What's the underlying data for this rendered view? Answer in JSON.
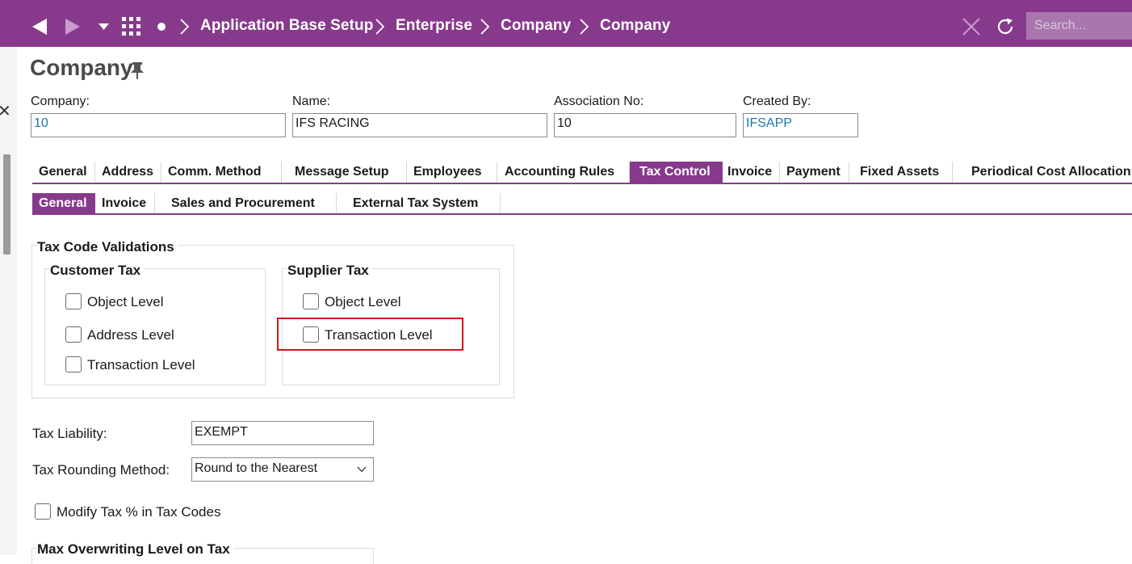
{
  "topbar": {
    "breadcrumb": [
      "Application Base Setup",
      "Enterprise",
      "Company",
      "Company"
    ],
    "search_placeholder": "Search...",
    "icons": [
      "back-arrow-icon",
      "forward-arrow-icon",
      "dropdown-icon",
      "apps-grid-icon",
      "dot-icon",
      "close-icon",
      "refresh-icon"
    ]
  },
  "page": {
    "title": "Company"
  },
  "header_fields": {
    "company_label": "Company:",
    "company_value": "10",
    "name_label": "Name:",
    "name_value": "IFS RACING",
    "assoc_label": "Association No:",
    "assoc_value": "10",
    "created_label": "Created By:",
    "created_value": "IFSAPP"
  },
  "tabs": [
    {
      "label": "General",
      "active": false
    },
    {
      "label": "Address",
      "active": false
    },
    {
      "label": "Comm. Method",
      "active": false
    },
    {
      "label": "Message Setup",
      "active": false
    },
    {
      "label": "Employees",
      "active": false
    },
    {
      "label": "Accounting Rules",
      "active": false
    },
    {
      "label": "Tax Control",
      "active": true
    },
    {
      "label": "Invoice",
      "active": false
    },
    {
      "label": "Payment",
      "active": false
    },
    {
      "label": "Fixed Assets",
      "active": false
    },
    {
      "label": "Periodical Cost Allocation",
      "active": false
    }
  ],
  "subtabs": [
    {
      "label": "General",
      "active": true
    },
    {
      "label": "Invoice",
      "active": false
    },
    {
      "label": "Sales and Procurement",
      "active": false
    },
    {
      "label": "External Tax System",
      "active": false
    }
  ],
  "tax_code_validations": {
    "title": "Tax Code Validations",
    "customer": {
      "title": "Customer Tax",
      "options": [
        {
          "label": "Object Level",
          "checked": false
        },
        {
          "label": "Address Level",
          "checked": false
        },
        {
          "label": "Transaction Level",
          "checked": false
        }
      ]
    },
    "supplier": {
      "title": "Supplier Tax",
      "options": [
        {
          "label": "Object Level",
          "checked": false
        },
        {
          "label": "Transaction Level",
          "checked": false
        }
      ]
    }
  },
  "tax_liability": {
    "label": "Tax Liability:",
    "value": "EXEMPT"
  },
  "tax_rounding": {
    "label": "Tax Rounding Method:",
    "value": "Round to the Nearest"
  },
  "modify_tax": {
    "label": "Modify Tax % in Tax Codes",
    "checked": false
  },
  "max_overwriting": {
    "label": "Max Overwriting Level on Tax"
  },
  "colors": {
    "brand": "#873a8c",
    "highlight": "#d0151b",
    "link": "#1a7aa5"
  }
}
